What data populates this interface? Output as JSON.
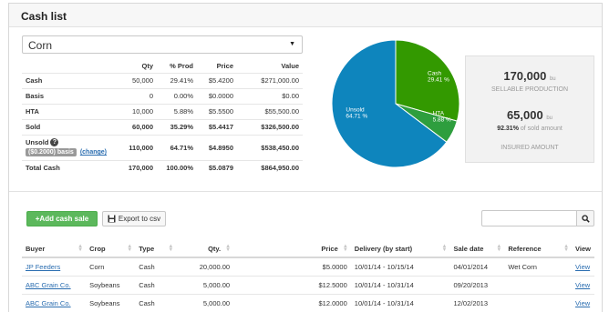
{
  "header": {
    "title": "Cash list"
  },
  "crop_select": {
    "value": "Corn"
  },
  "cash_table": {
    "columns": [
      "Qty",
      "% Prod",
      "Price",
      "Value"
    ],
    "rows": [
      {
        "name": "Cash",
        "qty": "50,000",
        "pct": "29.41%",
        "price": "$5.4200",
        "value": "$271,000.00"
      },
      {
        "name": "Basis",
        "qty": "0",
        "pct": "0.00%",
        "price": "$0.0000",
        "value": "$0.00"
      },
      {
        "name": "HTA",
        "qty": "10,000",
        "pct": "5.88%",
        "price": "$5.5500",
        "value": "$55,500.00"
      },
      {
        "name": "Sold",
        "qty": "60,000",
        "pct": "35.29%",
        "price": "$5.4417",
        "value": "$326,500.00"
      }
    ],
    "unsold": {
      "name": "Unsold",
      "help": "?",
      "basis_badge": "($0.2000) basis",
      "change_link": "(change)",
      "qty": "110,000",
      "pct": "64.71%",
      "price": "$4.8950",
      "value": "$538,450.00"
    },
    "total": {
      "name": "Total Cash",
      "qty": "170,000",
      "pct": "100.00%",
      "price": "$5.0879",
      "value": "$864,950.00"
    }
  },
  "pie": {
    "slices": [
      {
        "label": "Cash",
        "pct_label": "29.41 %",
        "value": 29.41,
        "color": "#339900"
      },
      {
        "label": "HTA",
        "pct_label": "5.88 %",
        "value": 5.88,
        "color": "#2e9e3e"
      },
      {
        "label": "Unsold",
        "pct_label": "64.71 %",
        "value": 64.71,
        "color": "#0e85bd"
      }
    ]
  },
  "stats": {
    "production_value": "170,000",
    "production_unit": "bu",
    "production_label": "SELLABLE PRODUCTION",
    "insured_value": "65,000",
    "insured_unit": "bu",
    "sold_pct": "92.31%",
    "sold_pct_text": "of sold amount",
    "insured_label": "INSURED AMOUNT"
  },
  "toolbar": {
    "add_label": "+Add cash sale",
    "export_label": "Export to csv",
    "search_value": ""
  },
  "sales": {
    "columns": [
      "Buyer",
      "Crop",
      "Type",
      "Qty.",
      "Price",
      "Delivery (by start)",
      "Sale date",
      "Reference",
      "View"
    ],
    "rows": [
      {
        "buyer": "JP Feeders",
        "crop": "Corn",
        "type": "Cash",
        "qty": "20,000.00",
        "price": "$5.0000",
        "delivery": "10/01/14 - 10/15/14",
        "sale_date": "04/01/2014",
        "reference": "Wet Corn",
        "view": "View"
      },
      {
        "buyer": "ABC Grain Co.",
        "crop": "Soybeans",
        "type": "Cash",
        "qty": "5,000.00",
        "price": "$12.5000",
        "delivery": "10/01/14 - 10/31/14",
        "sale_date": "09/20/2013",
        "reference": "",
        "view": "View"
      },
      {
        "buyer": "ABC Grain Co.",
        "crop": "Soybeans",
        "type": "Cash",
        "qty": "5,000.00",
        "price": "$12.0000",
        "delivery": "10/01/14 - 10/31/14",
        "sale_date": "12/02/2013",
        "reference": "",
        "view": "View"
      }
    ]
  },
  "icons": {
    "caret": "caret-down-icon",
    "export": "save-icon",
    "search": "search-icon",
    "sort": "sort-icon",
    "help": "help-icon"
  }
}
